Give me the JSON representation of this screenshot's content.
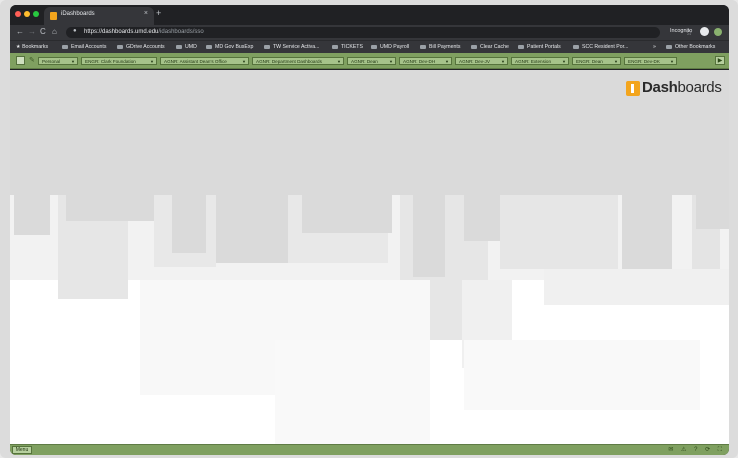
{
  "browser": {
    "tab_title": "iDashboards",
    "tab_close": "×",
    "new_tab": "+",
    "url_host": "https://dashboards.umd.edu",
    "url_path": "/idashboards/sso",
    "profile_label": "Incognito",
    "nav": {
      "back": "←",
      "forward": "→",
      "reload": "C",
      "home": "⌂"
    },
    "star": "☆",
    "lock": "🔒"
  },
  "bookmarks": [
    "Bookmarks",
    "Email Accounts",
    "GDrive Accounts",
    "UMD",
    "MD Gov BusExp",
    "TW Service Activa...",
    "TICKETS",
    "UMD Payroll",
    "Bill Payments",
    "Clear Cache",
    "Patient Portals",
    "SCC Resident Por...",
    "»",
    "Other Bookmarks"
  ],
  "dashboard_tabs": [
    "Personal",
    "ENGR: Clark Foundation",
    "AGNR: Assistant Dean's Office",
    "AGNR: Department Dashboards",
    "AGNR: Dean",
    "AGNR: Dev-DH",
    "AGNR: Dev-JV",
    "AGNR: Extension",
    "ENGR: Dean",
    "ENGR: Dev-DK"
  ],
  "tab_arrow": "▼",
  "play": "▶",
  "logo": {
    "text_bold": "Dash",
    "text_rest": "boards",
    "brand_color": "#f3a51d"
  },
  "footer": {
    "menu_label": "Menu",
    "icons": "✉ ⚠ ? ⟳ ⛶"
  },
  "colors": {
    "app_green": "#7fa060",
    "tab_green": "#a6c38a"
  }
}
